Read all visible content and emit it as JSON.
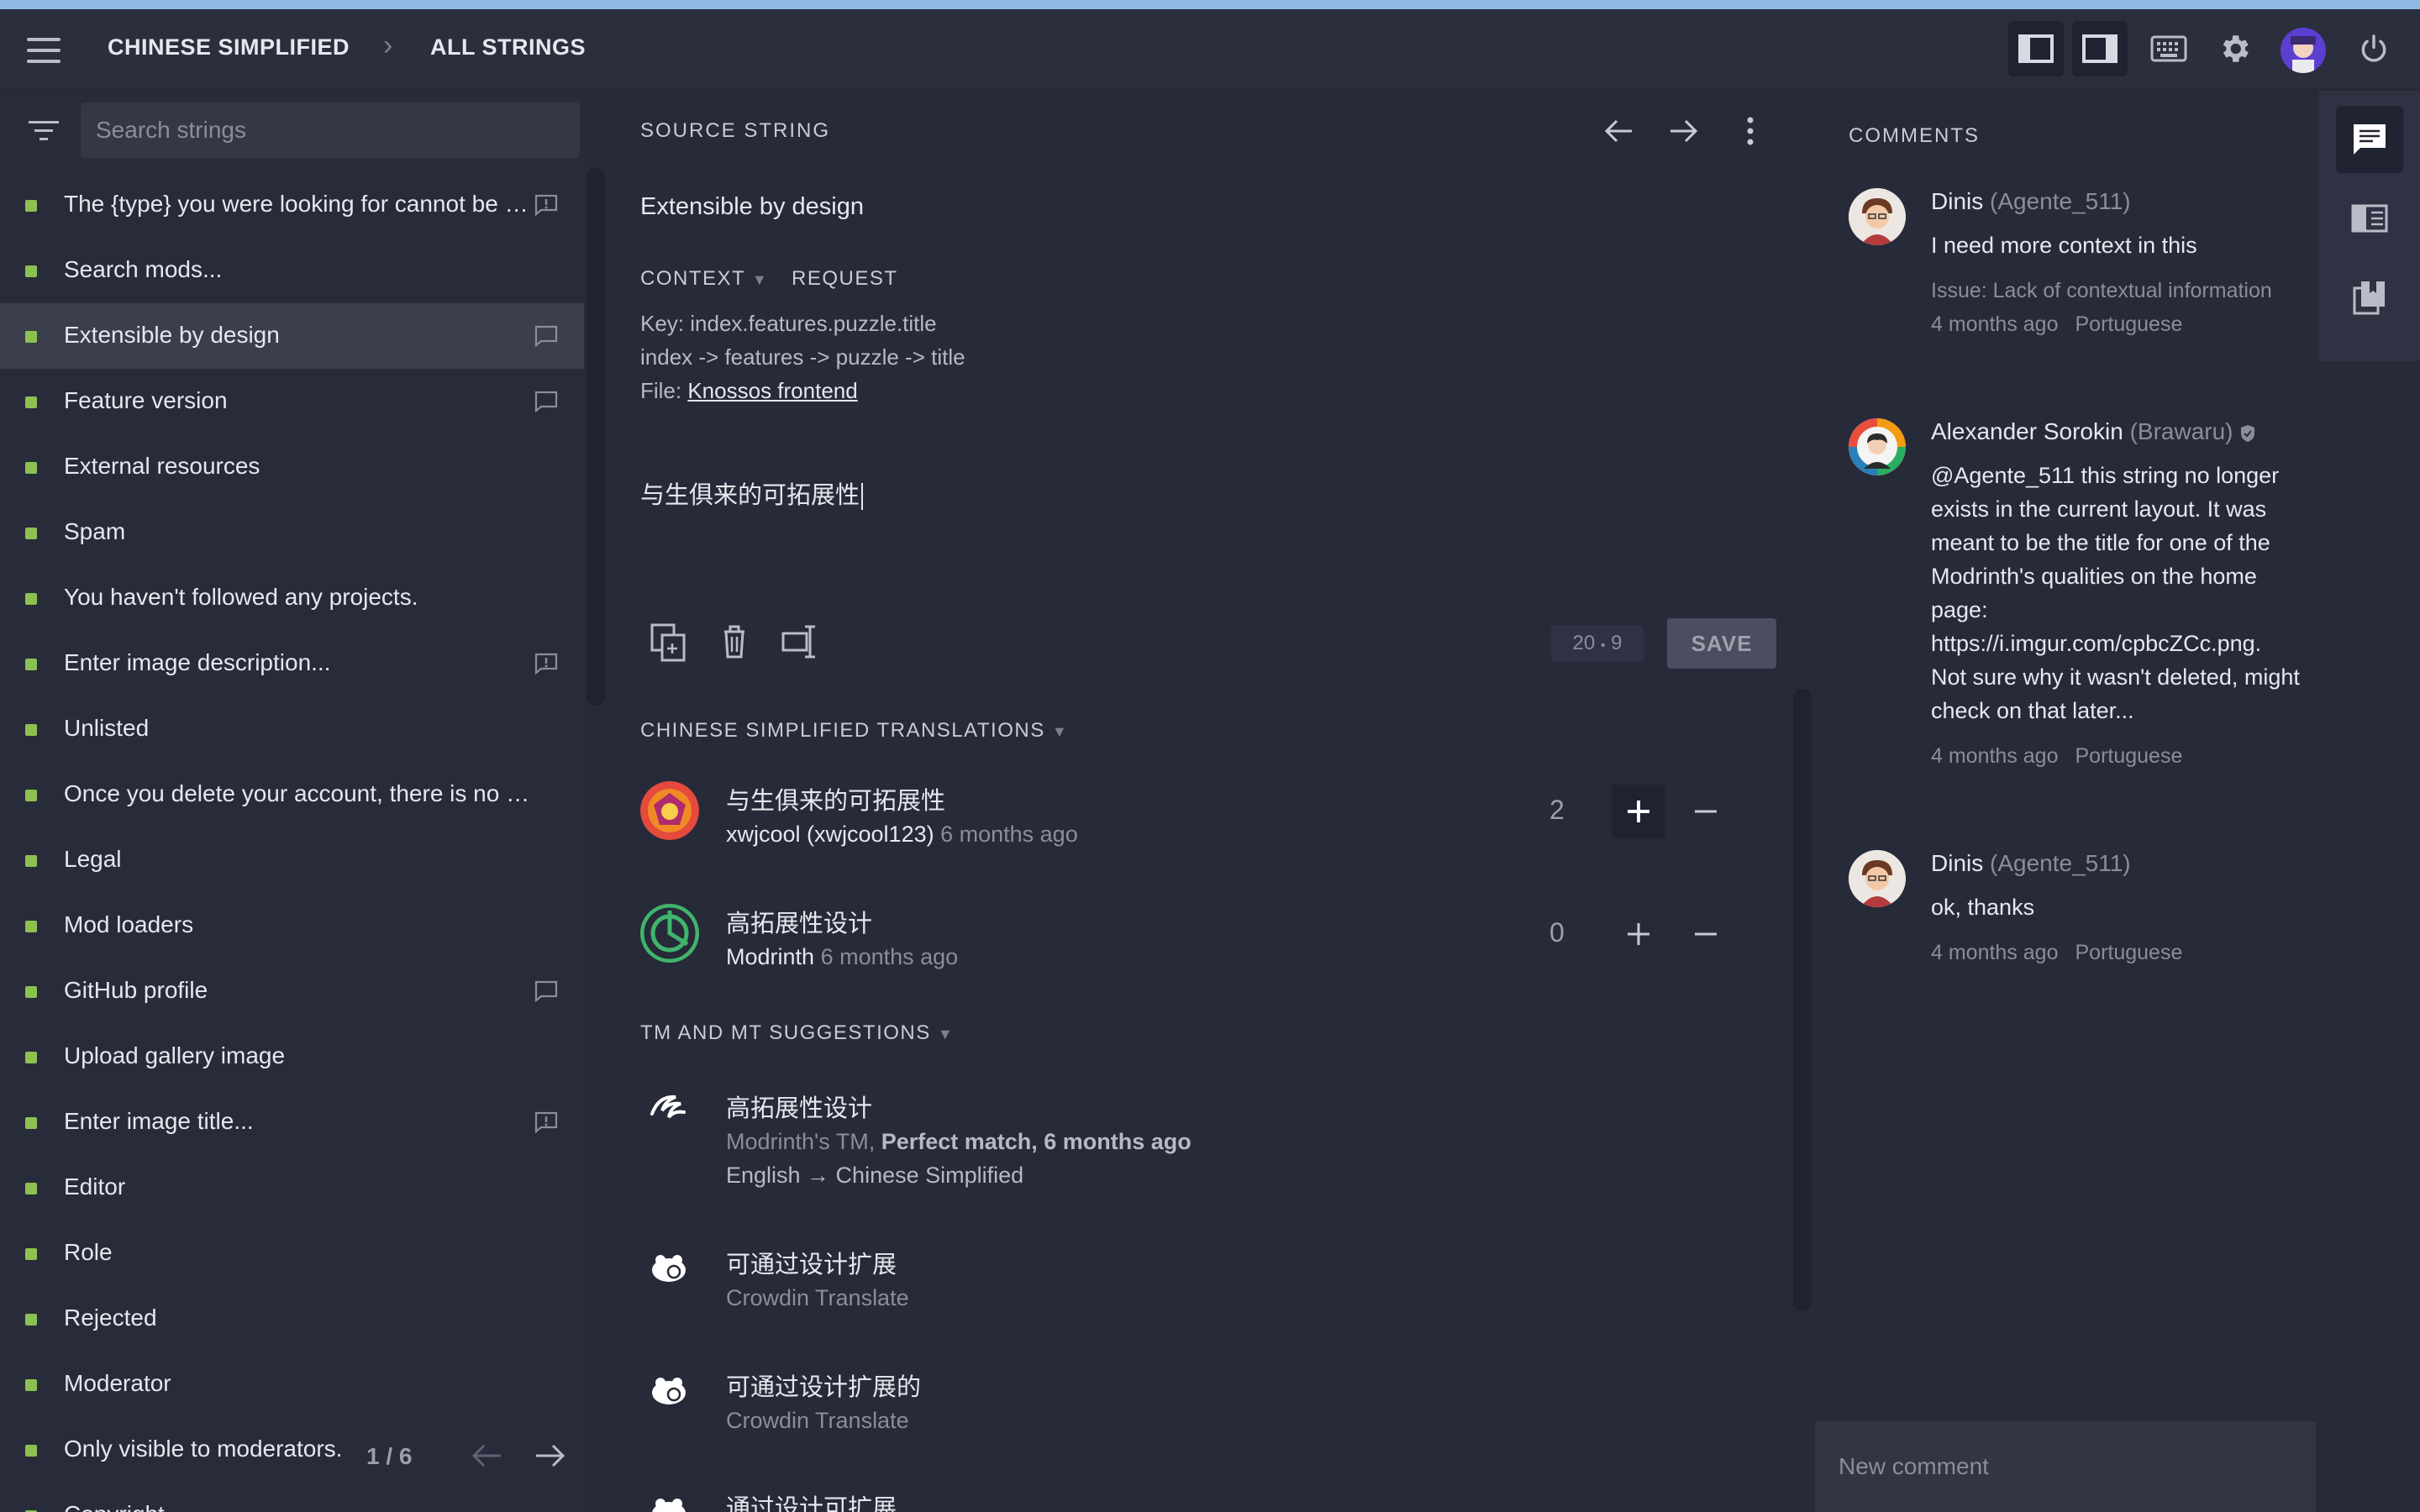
{
  "header": {
    "language": "CHINESE SIMPLIFIED",
    "section": "ALL STRINGS"
  },
  "sidebar": {
    "search_placeholder": "Search strings",
    "items": [
      {
        "label": "The {type} you were looking for cannot be f…",
        "icon": "issue-icon"
      },
      {
        "label": "Search mods...",
        "icon": ""
      },
      {
        "label": "Extensible by design",
        "icon": "comment-icon",
        "selected": true
      },
      {
        "label": "Feature version",
        "icon": "comment-icon"
      },
      {
        "label": "External resources",
        "icon": ""
      },
      {
        "label": "Spam",
        "icon": ""
      },
      {
        "label": "You haven't followed any projects.",
        "icon": ""
      },
      {
        "label": "Enter image description...",
        "icon": "issue-icon"
      },
      {
        "label": "Unlisted",
        "icon": ""
      },
      {
        "label": "Once you delete your account, there is no goin…",
        "icon": ""
      },
      {
        "label": "Legal",
        "icon": ""
      },
      {
        "label": "Mod loaders",
        "icon": ""
      },
      {
        "label": "GitHub profile",
        "icon": "comment-icon"
      },
      {
        "label": "Upload gallery image",
        "icon": ""
      },
      {
        "label": "Enter image title...",
        "icon": "issue-icon"
      },
      {
        "label": "Editor",
        "icon": ""
      },
      {
        "label": "Role",
        "icon": ""
      },
      {
        "label": "Rejected",
        "icon": ""
      },
      {
        "label": "Moderator",
        "icon": ""
      },
      {
        "label": "Only visible to moderators.",
        "icon": ""
      },
      {
        "label": "Copyright",
        "icon": ""
      }
    ],
    "pager": "1 / 6"
  },
  "source": {
    "label": "SOURCE STRING",
    "text": "Extensible by design",
    "context_label": "CONTEXT",
    "request_label": "REQUEST",
    "key": "Key: index.features.puzzle.title",
    "path": "index -> features -> puzzle -> title",
    "file_prefix": "File: ",
    "file_link": "Knossos frontend"
  },
  "editor": {
    "translation_text": "与生俱来的可拓展性",
    "counter_a": "20",
    "counter_b": "9",
    "save_label": "SAVE"
  },
  "translations": {
    "label": "CHINESE SIMPLIFIED TRANSLATIONS",
    "items": [
      {
        "text": "与生俱来的可拓展性",
        "author": "xwjcool (xwjcool123)",
        "time": "6 months ago",
        "votes": "2"
      },
      {
        "text": "高拓展性设计",
        "author": "Modrinth",
        "time": "6 months ago",
        "votes": "0"
      }
    ]
  },
  "suggestions": {
    "label": "TM AND MT SUGGESTIONS",
    "items": [
      {
        "text": "高拓展性设计",
        "source": "Modrinth's TM, ",
        "match": "Perfect match, 6 months ago",
        "lang": "English → Chinese Simplified"
      },
      {
        "text": "可通过设计扩展",
        "source": "Crowdin Translate"
      },
      {
        "text": "可通过设计扩展的",
        "source": "Crowdin Translate"
      },
      {
        "text": "通过设计可扩展",
        "source": ""
      }
    ]
  },
  "comments": {
    "label": "COMMENTS",
    "new_placeholder": "New comment",
    "items": [
      {
        "name": "Dinis",
        "nick": "(Agente_511)",
        "text": "I need more context in this",
        "issue": "Issue: Lack of contextual information",
        "time": "4 months ago",
        "lang": "Portuguese"
      },
      {
        "name": "Alexander Sorokin",
        "nick": "(Brawaru)",
        "text": "@Agente_511 this string no longer exists in the current layout. It was meant to be the title for one of the Modrinth's qualities on the home page: https://i.imgur.com/cpbcZCc.png. Not sure why it wasn't deleted, might check on that later...",
        "time": "4 months ago",
        "lang": "Portuguese"
      },
      {
        "name": "Dinis",
        "nick": "(Agente_511)",
        "text": "ok, thanks",
        "time": "4 months ago",
        "lang": "Portuguese"
      }
    ]
  },
  "colors": {
    "accent_green": "#8cc152",
    "bg": "#272a39",
    "topline": "#8fb9e4"
  }
}
